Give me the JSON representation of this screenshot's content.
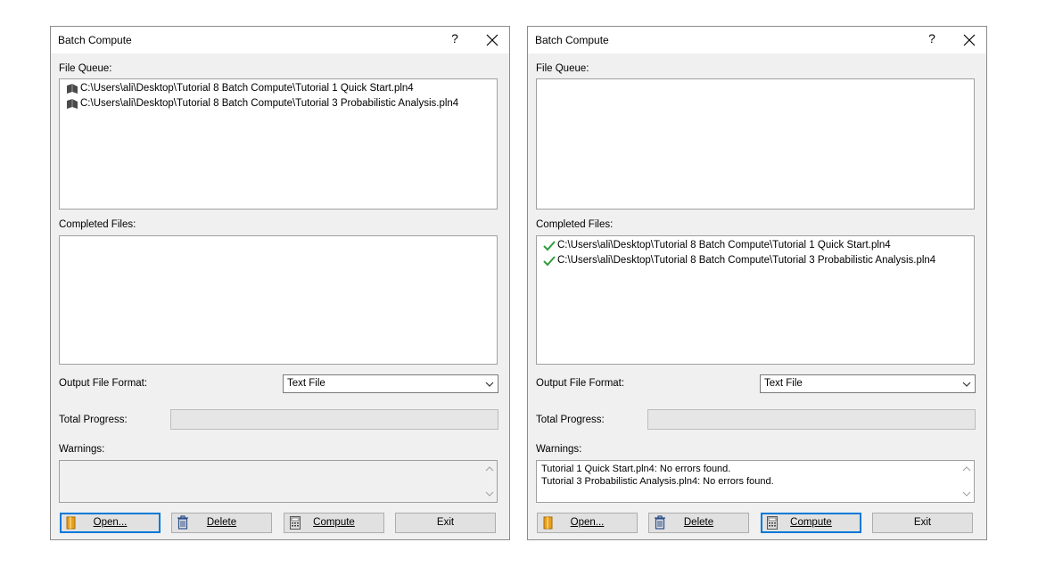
{
  "dialogs": [
    {
      "title": "Batch Compute",
      "help_label": "?",
      "file_queue_label": "File Queue:",
      "file_queue": [
        "C:\\Users\\ali\\Desktop\\Tutorial 8 Batch Compute\\Tutorial 1 Quick Start.pln4",
        "C:\\Users\\ali\\Desktop\\Tutorial 8 Batch Compute\\Tutorial 3 Probabilistic Analysis.pln4"
      ],
      "completed_label": "Completed Files:",
      "completed": [],
      "output_format_label": "Output File Format:",
      "output_format_value": "Text File",
      "progress_label": "Total Progress:",
      "progress": 0,
      "warnings_label": "Warnings:",
      "warnings": [],
      "buttons": {
        "open": "Open...",
        "delete": "Delete",
        "compute": "Compute",
        "exit": "Exit"
      },
      "default_button": "open"
    },
    {
      "title": "Batch Compute",
      "help_label": "?",
      "file_queue_label": "File Queue:",
      "file_queue": [],
      "completed_label": "Completed Files:",
      "completed": [
        "C:\\Users\\ali\\Desktop\\Tutorial 8 Batch Compute\\Tutorial 1 Quick Start.pln4",
        "C:\\Users\\ali\\Desktop\\Tutorial 8 Batch Compute\\Tutorial 3 Probabilistic Analysis.pln4"
      ],
      "output_format_label": "Output File Format:",
      "output_format_value": "Text File",
      "progress_label": "Total Progress:",
      "progress": 0,
      "warnings_label": "Warnings:",
      "warnings": [
        "Tutorial 1 Quick Start.pln4: No errors found.",
        "Tutorial 3 Probabilistic Analysis.pln4: No errors found."
      ],
      "buttons": {
        "open": "Open...",
        "delete": "Delete",
        "compute": "Compute",
        "exit": "Exit"
      },
      "default_button": "compute"
    }
  ],
  "icons": {
    "file_item": "pending-file-icon",
    "completed_item": "checkmark-icon",
    "open": "folder-open-icon",
    "delete": "trash-icon",
    "compute": "calculator-icon"
  },
  "colors": {
    "default_button_border": "#0078d7",
    "checkmark": "#2e9e3a",
    "dialog_bg": "#f0f0f0"
  }
}
